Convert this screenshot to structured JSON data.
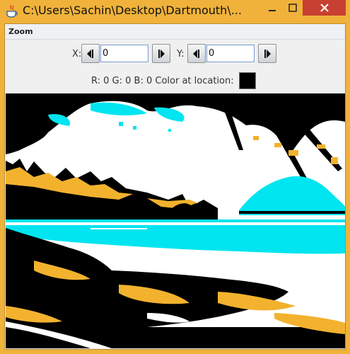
{
  "window": {
    "title": "C:\\Users\\Sachin\\Desktop\\Dartmouth\\..."
  },
  "menu": {
    "zoom_label": "Zoom"
  },
  "controls": {
    "x_label": "X:",
    "x_value": "0",
    "y_label": "Y:",
    "y_value": "0"
  },
  "status": {
    "color_readout": "R: 0  G: 0  B: 0  Color at location:",
    "swatch_color": "#000000"
  },
  "colors": {
    "title_bar": "#f0b23a",
    "close_button": "#c74031",
    "image_cyan": "#00e5f0",
    "image_gold": "#f2b22e",
    "image_black": "#000000"
  },
  "icons": {
    "title": "java-coffee-cup-icon",
    "decrement": "left-triangle-icon",
    "increment": "right-triangle-icon"
  }
}
